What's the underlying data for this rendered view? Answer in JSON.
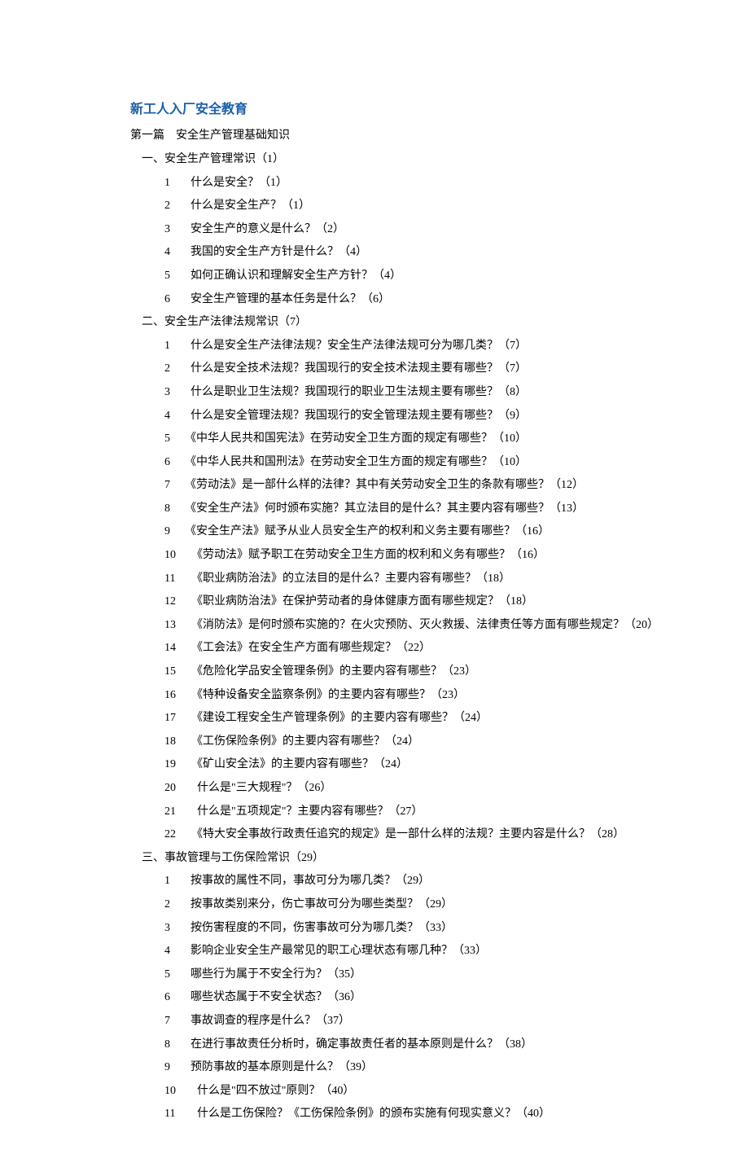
{
  "title": "新工人入厂安全教育",
  "part1": {
    "heading": "第一篇　安全生产管理基础知识",
    "sections": [
      {
        "heading": "一、安全生产管理常识（1）",
        "items": [
          {
            "num": "1",
            "text": "什么是安全？（1）"
          },
          {
            "num": "2",
            "text": "什么是安全生产？（1）"
          },
          {
            "num": "3",
            "text": "安全生产的意义是什么？（2）"
          },
          {
            "num": "4",
            "text": "我国的安全生产方针是什么？（4）"
          },
          {
            "num": "5",
            "text": "如何正确认识和理解安全生产方针？（4）"
          },
          {
            "num": "6",
            "text": "安全生产管理的基本任务是什么？（6）"
          }
        ]
      },
      {
        "heading": "二、安全生产法律法规常识（7）",
        "items": [
          {
            "num": "1",
            "text": "什么是安全生产法律法规？安全生产法律法规可分为哪几类？（7）"
          },
          {
            "num": "2",
            "text": "什么是安全技术法规？我国现行的安全技术法规主要有哪些？（7）"
          },
          {
            "num": "3",
            "text": "什么是职业卫生法规？我国现行的职业卫生法规主要有哪些？（8）"
          },
          {
            "num": "4",
            "text": "什么是安全管理法规？我国现行的安全管理法规主要有哪些？（9）"
          },
          {
            "num": "5",
            "text": "《中华人民共和国宪法》在劳动安全卫生方面的规定有哪些？（10）"
          },
          {
            "num": "6",
            "text": "《中华人民共和国刑法》在劳动安全卫生方面的规定有哪些？（10）"
          },
          {
            "num": "7",
            "text": "《劳动法》是一部什么样的法律？其中有关劳动安全卫生的条款有哪些？（12）"
          },
          {
            "num": "8",
            "text": "《安全生产法》何时颁布实施？其立法目的是什么？其主要内容有哪些？（13）"
          },
          {
            "num": "9",
            "text": "《安全生产法》赋予从业人员安全生产的权利和义务主要有哪些？（16）"
          },
          {
            "num": "10",
            "text": "《劳动法》赋予职工在劳动安全卫生方面的权利和义务有哪些？（16）"
          },
          {
            "num": "11",
            "text": "《职业病防治法》的立法目的是什么？主要内容有哪些？（18）"
          },
          {
            "num": "12",
            "text": "《职业病防治法》在保护劳动者的身体健康方面有哪些规定？（18）"
          },
          {
            "num": "13",
            "text": "《消防法》是何时颁布实施的？在火灾预防、灭火救援、法律责任等方面有哪些规定？（20）"
          },
          {
            "num": "14",
            "text": "《工会法》在安全生产方面有哪些规定？（22）"
          },
          {
            "num": "15",
            "text": "《危险化学品安全管理条例》的主要内容有哪些？（23）"
          },
          {
            "num": "16",
            "text": "《特种设备安全监察条例》的主要内容有哪些？（23）"
          },
          {
            "num": "17",
            "text": "《建设工程安全生产管理条例》的主要内容有哪些？（24）"
          },
          {
            "num": "18",
            "text": "《工伤保险条例》的主要内容有哪些？（24）"
          },
          {
            "num": "19",
            "text": "《矿山安全法》的主要内容有哪些？（24）"
          },
          {
            "num": "20",
            "text": "什么是\"三大规程\"？（26）"
          },
          {
            "num": "21",
            "text": "什么是\"五项规定\"？主要内容有哪些？（27）"
          },
          {
            "num": "22",
            "text": "《特大安全事故行政责任追究的规定》是一部什么样的法规？主要内容是什么？（28）"
          }
        ]
      },
      {
        "heading": "三、事故管理与工伤保险常识（29）",
        "items": [
          {
            "num": "1",
            "text": "按事故的属性不同，事故可分为哪几类？（29）"
          },
          {
            "num": "2",
            "text": "按事故类别来分，伤亡事故可分为哪些类型？（29）"
          },
          {
            "num": "3",
            "text": "按伤害程度的不同，伤害事故可分为哪几类？（33）"
          },
          {
            "num": "4",
            "text": "影响企业安全生产最常见的职工心理状态有哪几种？（33）"
          },
          {
            "num": "5",
            "text": "哪些行为属于不安全行为？（35）"
          },
          {
            "num": "6",
            "text": "哪些状态属于不安全状态？（36）"
          },
          {
            "num": "7",
            "text": "事故调查的程序是什么？（37）"
          },
          {
            "num": "8",
            "text": "在进行事故责任分析时，确定事故责任者的基本原则是什么？（38）"
          },
          {
            "num": "9",
            "text": "预防事故的基本原则是什么？（39）"
          },
          {
            "num": "10",
            "text": "什么是\"四不放过\"原则？（40）"
          },
          {
            "num": "11",
            "text": "什么是工伤保险？《工伤保险条例》的颁布实施有何现实意义？（40）"
          }
        ]
      }
    ]
  }
}
